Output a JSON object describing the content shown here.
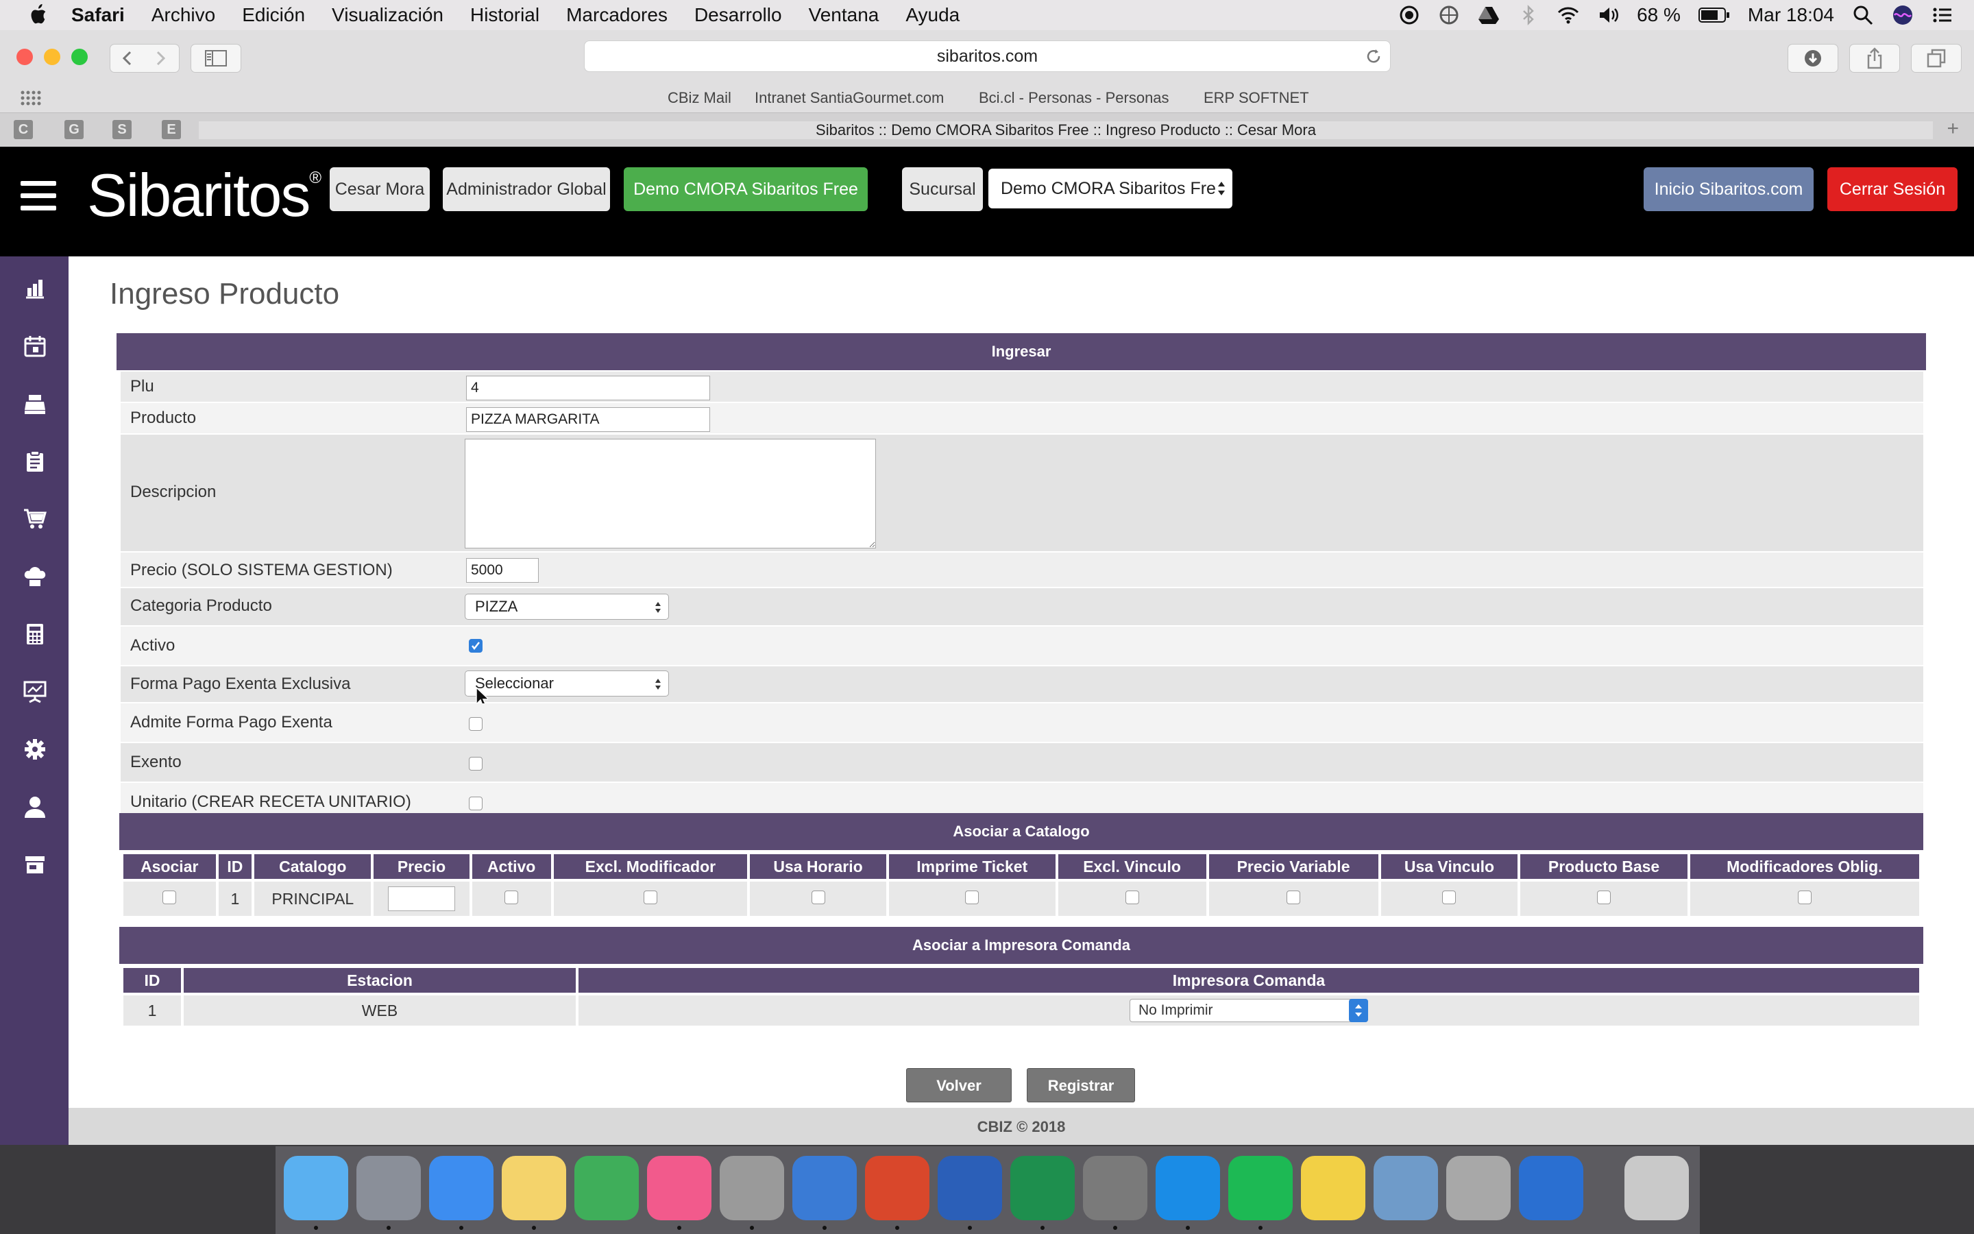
{
  "menubar": {
    "items": [
      "Safari",
      "Archivo",
      "Edición",
      "Visualización",
      "Historial",
      "Marcadores",
      "Desarrollo",
      "Ventana",
      "Ayuda"
    ],
    "battery": "68 %",
    "clock": "Mar 18:04"
  },
  "browser": {
    "url": "sibaritos.com",
    "favorites": [
      "CBiz Mail",
      "Intranet SantiaGourmet.com",
      "Bci.cl - Personas - Personas",
      "ERP SOFTNET"
    ],
    "pinned_tabs": [
      "C",
      "G",
      "S",
      "E"
    ],
    "tab_title": "Sibaritos :: Demo CMORA Sibaritos Free :: Ingreso Producto :: Cesar Mora",
    "new_tab": "+"
  },
  "header": {
    "logo": "Sibaritos",
    "logo_mark": "®",
    "user_button": "Cesar Mora",
    "role_button": "Administrador Global",
    "company_button": "Demo CMORA Sibaritos Free",
    "branch_label": "Sucursal",
    "branch_select": "Demo CMORA Sibaritos Fre",
    "home_button": "Inicio Sibaritos.com",
    "logout_button": "Cerrar Sesión"
  },
  "sidebar": {
    "icons": [
      "bar-chart-icon",
      "calendar-icon",
      "cash-register-icon",
      "clipboard-icon",
      "shopping-cart-icon",
      "chef-hat-icon",
      "calculator-icon",
      "presentation-icon",
      "gear-icon",
      "user-icon",
      "store-icon"
    ]
  },
  "page": {
    "title": "Ingreso Producto",
    "section_ingresar": "Ingresar",
    "fields": {
      "plu_label": "Plu",
      "plu_value": "4",
      "producto_label": "Producto",
      "producto_value": "PIZZA MARGARITA",
      "descripcion_label": "Descripcion",
      "descripcion_value": "",
      "precio_label": "Precio (SOLO SISTEMA GESTION)",
      "precio_value": "5000",
      "categoria_label": "Categoria Producto",
      "categoria_value": "PIZZA",
      "activo_label": "Activo",
      "activo_checked": true,
      "forma_pago_label": "Forma Pago Exenta Exclusiva",
      "forma_pago_value": "Seleccionar",
      "admite_label": "Admite Forma Pago Exenta",
      "admite_checked": false,
      "exento_label": "Exento",
      "exento_checked": false,
      "unitario_label": "Unitario (CREAR RECETA UNITARIO)",
      "unitario_checked": false
    },
    "catalogo": {
      "title": "Asociar a Catalogo",
      "columns": [
        "Asociar",
        "ID",
        "Catalogo",
        "Precio",
        "Activo",
        "Excl. Modificador",
        "Usa Horario",
        "Imprime Ticket",
        "Excl. Vinculo",
        "Precio Variable",
        "Usa Vinculo",
        "Producto Base",
        "Modificadores Oblig."
      ],
      "row": {
        "id": "1",
        "catalogo": "PRINCIPAL",
        "precio": ""
      }
    },
    "impresora": {
      "title": "Asociar a Impresora Comanda",
      "columns": [
        "ID",
        "Estacion",
        "Impresora Comanda"
      ],
      "row": {
        "id": "1",
        "estacion": "WEB",
        "impresora": "No Imprimir"
      }
    },
    "buttons": {
      "back": "Volver",
      "submit": "Registrar"
    },
    "footer": "CBIZ © 2018"
  },
  "dock": {
    "apps": [
      "finder-icon",
      "launchpad-icon",
      "safari-icon",
      "textedit-icon",
      "numbers-icon",
      "itunes-icon",
      "calculator-app-icon",
      "keynote-icon",
      "powerpoint-icon",
      "word-icon",
      "excel-icon",
      "system-preferences-icon",
      "teamviewer-icon",
      "spotify-icon",
      "stickies-icon",
      "preview-icon",
      "printer-icon",
      "quicktime-icon",
      "trash-icon"
    ]
  },
  "colors": {
    "brand_purple": "#5a4a72",
    "sidebar_purple": "#4b3a68",
    "green": "#4cae4c",
    "red": "#e02020",
    "blue_gray": "#6b7fa8"
  }
}
